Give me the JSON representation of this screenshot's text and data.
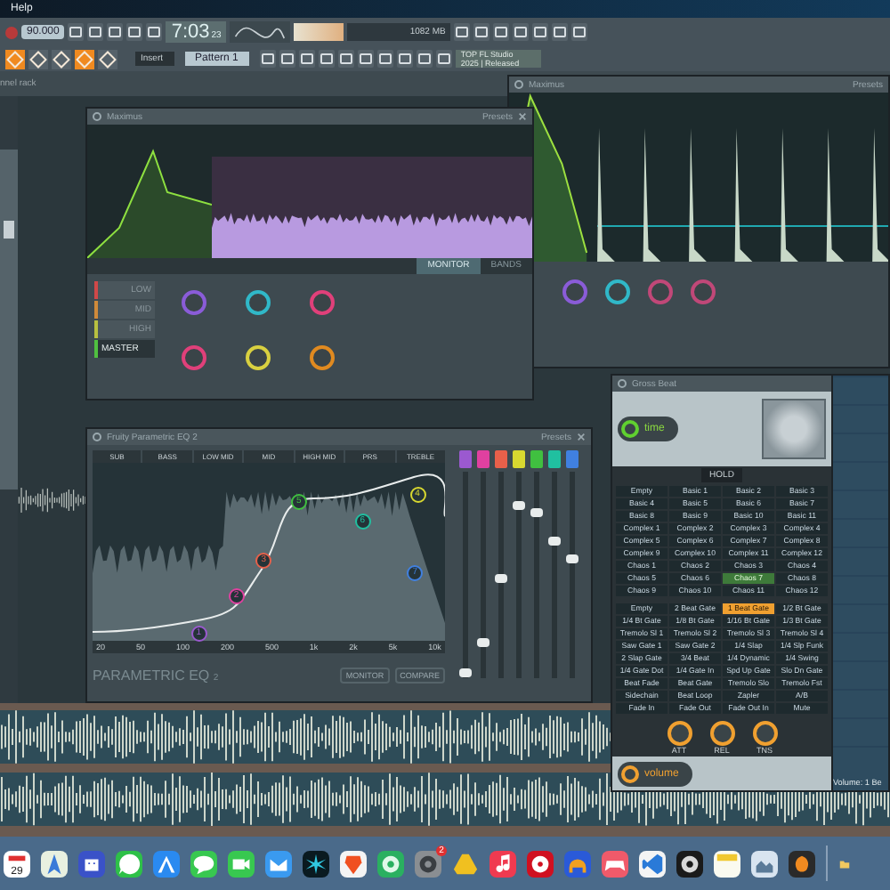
{
  "menu_bar": {
    "items": [
      "Help"
    ]
  },
  "toolbar": {
    "tempo": "90.000",
    "time": "7:03",
    "time_small": "23",
    "memory": "1082 MB",
    "snap": "Insert",
    "pattern": "Pattern 1",
    "tools": [
      {
        "selected": true
      },
      {
        "selected": false
      },
      {
        "selected": false
      },
      {
        "selected": true
      },
      {
        "selected": false
      }
    ],
    "news": [
      "TOP FL Studio",
      "2025 | Released"
    ]
  },
  "channel_rack": {
    "title": "nnel rack"
  },
  "maximus_back": {
    "title": "Maximus",
    "presets": "Presets",
    "knobs": [
      {
        "color": "#8a5cd8"
      },
      {
        "color": "#30b8c8"
      },
      {
        "color": "#c04878"
      },
      {
        "color": "#c04878"
      }
    ]
  },
  "maximus": {
    "title": "Maximus",
    "presets": "Presets",
    "bands": [
      {
        "label": "LOW",
        "color": "#d04848",
        "selected": false
      },
      {
        "label": "MID",
        "color": "#d08a3a",
        "selected": false
      },
      {
        "label": "HIGH",
        "color": "#b8c040",
        "selected": false
      },
      {
        "label": "MASTER",
        "color": "#50c040",
        "selected": true
      }
    ],
    "tabs": [
      {
        "label": "MONITOR",
        "selected": true
      },
      {
        "label": "BANDS",
        "selected": false
      }
    ],
    "knobs": [
      {
        "color": "#8a5cd8"
      },
      {
        "color": "#30b8c8"
      },
      {
        "color": "#e0407a"
      },
      {
        "color": "#e0407a"
      },
      {
        "color": "#d8d040"
      },
      {
        "color": "#e08a20"
      }
    ]
  },
  "eq": {
    "title": "Fruity Parametric EQ 2",
    "presets": "Presets",
    "regions": [
      "SUB",
      "BASS",
      "LOW MID",
      "MID",
      "HIGH MID",
      "PRS",
      "TREBLE"
    ],
    "frequencies": [
      "20",
      "50",
      "100",
      "200",
      "500",
      "1k",
      "2k",
      "5k",
      "10k"
    ],
    "bands": [
      {
        "number": "1",
        "color": "#9b59d0",
        "level": 0.03
      },
      {
        "number": "2",
        "color": "#e040a0",
        "level": 0.17
      },
      {
        "number": "3",
        "color": "#e8604a",
        "level": 0.48
      },
      {
        "number": "4",
        "color": "#d8d830",
        "level": 0.84
      },
      {
        "number": "5",
        "color": "#40c040",
        "level": 0.8
      },
      {
        "number": "6",
        "color": "#20c0a0",
        "level": 0.66
      },
      {
        "number": "7",
        "color": "#4080e0",
        "level": 0.58
      }
    ],
    "logo": "PARAMETRIC EQ",
    "logo_sub": "2",
    "buttons": [
      "MONITOR",
      "COMPARE"
    ]
  },
  "gross_beat": {
    "title": "Gross Beat",
    "time_label": "time",
    "hold": "HOLD",
    "time_presets": [
      {
        "label": "Empty",
        "selected": false
      },
      {
        "label": "Basic 1",
        "selected": false
      },
      {
        "label": "Basic 2",
        "selected": false
      },
      {
        "label": "Basic 3",
        "selected": false
      },
      {
        "label": "Basic 4",
        "selected": false
      },
      {
        "label": "Basic 5",
        "selected": false
      },
      {
        "label": "Basic 6",
        "selected": false
      },
      {
        "label": "Basic 7",
        "selected": false
      },
      {
        "label": "Basic 8",
        "selected": false
      },
      {
        "label": "Basic 9",
        "selected": false
      },
      {
        "label": "Basic 10",
        "selected": false
      },
      {
        "label": "Basic 11",
        "selected": false
      },
      {
        "label": "Complex 1",
        "selected": false
      },
      {
        "label": "Complex 2",
        "selected": false
      },
      {
        "label": "Complex 3",
        "selected": false
      },
      {
        "label": "Complex 4",
        "selected": false
      },
      {
        "label": "Complex 5",
        "selected": false
      },
      {
        "label": "Complex 6",
        "selected": false
      },
      {
        "label": "Complex 7",
        "selected": false
      },
      {
        "label": "Complex 8",
        "selected": false
      },
      {
        "label": "Complex 9",
        "selected": false
      },
      {
        "label": "Complex 10",
        "selected": false
      },
      {
        "label": "Complex 11",
        "selected": false
      },
      {
        "label": "Complex 12",
        "selected": false
      },
      {
        "label": "Chaos 1",
        "selected": false
      },
      {
        "label": "Chaos 2",
        "selected": false
      },
      {
        "label": "Chaos 3",
        "selected": false
      },
      {
        "label": "Chaos 4",
        "selected": false
      },
      {
        "label": "Chaos 5",
        "selected": false
      },
      {
        "label": "Chaos 6",
        "selected": false
      },
      {
        "label": "Chaos 7",
        "selected": true
      },
      {
        "label": "Chaos 8",
        "selected": false
      },
      {
        "label": "Chaos 9",
        "selected": false
      },
      {
        "label": "Chaos 10",
        "selected": false
      },
      {
        "label": "Chaos 11",
        "selected": false
      },
      {
        "label": "Chaos 12",
        "selected": false
      }
    ],
    "volume_presets": [
      {
        "label": "Empty",
        "selected": false
      },
      {
        "label": "2 Beat Gate",
        "selected": false
      },
      {
        "label": "1 Beat Gate",
        "selected": true
      },
      {
        "label": "1/2 Bt Gate",
        "selected": false
      },
      {
        "label": "1/4 Bt Gate",
        "selected": false
      },
      {
        "label": "1/8 Bt Gate",
        "selected": false
      },
      {
        "label": "1/16 Bt Gate",
        "selected": false
      },
      {
        "label": "1/3 Bt Gate",
        "selected": false
      },
      {
        "label": "Tremolo Sl 1",
        "selected": false
      },
      {
        "label": "Tremolo Sl 2",
        "selected": false
      },
      {
        "label": "Tremolo Sl 3",
        "selected": false
      },
      {
        "label": "Tremolo Sl 4",
        "selected": false
      },
      {
        "label": "Saw Gate 1",
        "selected": false
      },
      {
        "label": "Saw Gate 2",
        "selected": false
      },
      {
        "label": "1/4 Slap",
        "selected": false
      },
      {
        "label": "1/4 Slp Funk",
        "selected": false
      },
      {
        "label": "2 Slap Gate",
        "selected": false
      },
      {
        "label": "3/4 Beat",
        "selected": false
      },
      {
        "label": "1/4 Dynamic",
        "selected": false
      },
      {
        "label": "1/4 Swing",
        "selected": false
      },
      {
        "label": "1/4 Gate Dot",
        "selected": false
      },
      {
        "label": "1/4 Gate In",
        "selected": false
      },
      {
        "label": "Spd Up Gate",
        "selected": false
      },
      {
        "label": "Slo Dn Gate",
        "selected": false
      },
      {
        "label": "Beat Fade",
        "selected": false
      },
      {
        "label": "Beat Gate",
        "selected": false
      },
      {
        "label": "Tremolo Slo",
        "selected": false
      },
      {
        "label": "Tremolo Fst",
        "selected": false
      },
      {
        "label": "Sidechain",
        "selected": false
      },
      {
        "label": "Beat Loop",
        "selected": false
      },
      {
        "label": "Zapler",
        "selected": false
      },
      {
        "label": "A/B",
        "selected": false
      },
      {
        "label": "Fade In",
        "selected": false
      },
      {
        "label": "Fade Out",
        "selected": false
      },
      {
        "label": "Fade Out In",
        "selected": false
      },
      {
        "label": "Mute",
        "selected": false
      }
    ],
    "knobs": [
      {
        "label": "ATT"
      },
      {
        "label": "REL"
      },
      {
        "label": "TNS"
      }
    ],
    "volume_label": "volume"
  },
  "piano_roll": {
    "status": "Volume: 1 Be"
  },
  "dock": {
    "apps": [
      {
        "kind": "calendar",
        "label": "29"
      },
      {
        "kind": "map"
      },
      {
        "kind": "robot"
      },
      {
        "kind": "phone"
      },
      {
        "kind": "store"
      },
      {
        "kind": "bubble"
      },
      {
        "kind": "camera"
      },
      {
        "kind": "mail"
      },
      {
        "kind": "burst"
      },
      {
        "kind": "shield"
      },
      {
        "kind": "radar"
      },
      {
        "kind": "gear",
        "badge": "2"
      },
      {
        "kind": "triangle"
      },
      {
        "kind": "note"
      },
      {
        "kind": "disc"
      },
      {
        "kind": "headphones"
      },
      {
        "kind": "gamepad"
      },
      {
        "kind": "ribbon"
      },
      {
        "kind": "speaker"
      },
      {
        "kind": "notes"
      },
      {
        "kind": "photo"
      },
      {
        "kind": "fruit"
      }
    ],
    "extras": [
      {
        "kind": "folder"
      }
    ]
  }
}
